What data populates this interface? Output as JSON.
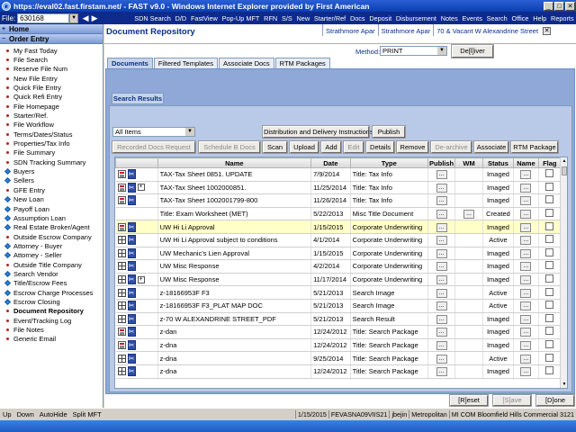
{
  "window": {
    "title": "https://eval02.fast.firstam.net/ - FAST v9.0 - Windows Internet Explorer provided by First American",
    "min": "_",
    "max": "□",
    "close": "✕"
  },
  "topbar": {
    "file_label": "File:",
    "file_number": "630168",
    "nav": [
      "SDN Search",
      "D/D",
      "FastView",
      "Pop-Up MFT",
      "RFN",
      "S/S",
      "New",
      "Starter/Ref",
      "Docs",
      "Deposit",
      "Disbursement",
      "Notes",
      "Events",
      "Search",
      "Office",
      "Help",
      "Reports"
    ]
  },
  "sidebar": {
    "home": "Home",
    "order_entry": "Order Entry",
    "items": [
      {
        "label": "My Fast Today",
        "bullet": "dot"
      },
      {
        "label": "File Search",
        "bullet": "dot"
      },
      {
        "label": "Reserve File Num",
        "bullet": "dot"
      },
      {
        "label": "New File Entry",
        "bullet": "dot"
      },
      {
        "label": "Quick File Entry",
        "bullet": "dot"
      },
      {
        "label": "Quick Refi Entry",
        "bullet": "dot"
      },
      {
        "label": "File Homepage",
        "bullet": "dot"
      },
      {
        "label": "Starter/Ref.",
        "bullet": "dot"
      },
      {
        "label": "File Workflow",
        "bullet": "dot"
      },
      {
        "label": "Terms/Dates/Status",
        "bullet": "dot"
      },
      {
        "label": "Properties/Tax Info",
        "bullet": "dot"
      },
      {
        "label": "File Summary",
        "bullet": "dot"
      },
      {
        "label": "SDN Tracking Summary",
        "bullet": "dot"
      },
      {
        "label": "Buyers",
        "bullet": "diamond"
      },
      {
        "label": "Sellers",
        "bullet": "diamond"
      },
      {
        "label": "GFE Entry",
        "bullet": "dot"
      },
      {
        "label": "New Loan",
        "bullet": "diamond"
      },
      {
        "label": "Payoff Loan",
        "bullet": "diamond"
      },
      {
        "label": "Assumption Loan",
        "bullet": "diamond"
      },
      {
        "label": "Real Estate Broker/Agent",
        "bullet": "diamond"
      },
      {
        "label": "Outside Escrow Company",
        "bullet": "dot"
      },
      {
        "label": "Attorney - Buyer",
        "bullet": "diamond"
      },
      {
        "label": "Attorney - Seller",
        "bullet": "diamond"
      },
      {
        "label": "Outside Title Company",
        "bullet": "dot"
      },
      {
        "label": "Search Vendor",
        "bullet": "diamond"
      },
      {
        "label": "Title/Escrow Fees",
        "bullet": "diamond"
      },
      {
        "label": "Escrow Charge Processes",
        "bullet": "diamond"
      },
      {
        "label": "Escrow Closing",
        "bullet": "diamond"
      },
      {
        "label": "Document Repository",
        "bullet": "dot",
        "active": true
      },
      {
        "label": "Event/Tracking Log",
        "bullet": "dot"
      },
      {
        "label": "File Notes",
        "bullet": "dot"
      },
      {
        "label": "Generic Email",
        "bullet": "dot"
      }
    ]
  },
  "header": {
    "page_title": "Document Repository",
    "cell1": "Strathmore Apar",
    "cell2": "Strathmore Apar",
    "cell3": "70 & Vacant W Alexandrine Street",
    "close": "✕"
  },
  "method": {
    "label": "Method:",
    "value": "PRINT",
    "deliver": "De[l]iver"
  },
  "tabs": [
    "Documents",
    "Filtered Templates",
    "Associate Docs",
    "RTM Packages"
  ],
  "search_results_tab": "Search Results",
  "filter_value": "All Items",
  "buttons": {
    "distribution": "Distribution and Delivery Instructions",
    "publish": "Publish",
    "recorded": "Recorded Docs Request",
    "schedule": "Schedule B Docs",
    "scan": "Scan",
    "upload": "Upload",
    "add": "Add",
    "edit": "Edit",
    "details": "Details",
    "remove": "Remove",
    "dearchive": "De-archive",
    "associate": "Associate",
    "rtm": "RTM Package",
    "reset": "[R]eset",
    "save": "[S]ave",
    "done": "[D]one"
  },
  "table": {
    "columns": [
      "",
      "Name",
      "Date",
      "Type",
      "Publish",
      "WM",
      "Status",
      "Name",
      "Flag"
    ],
    "rows": [
      {
        "icon": "doc",
        "plus": false,
        "name": "TAX-Tax Sheet 0851. UPDATE",
        "date": "7/9/2014",
        "type": "Title: Tax Info",
        "wm": "",
        "status": "Imaged",
        "hl": false
      },
      {
        "icon": "doc",
        "plus": true,
        "name": "TAX-Tax Sheet 1002000851.",
        "date": "11/25/2014",
        "type": "Title: Tax Info",
        "wm": "",
        "status": "Imaged",
        "hl": false
      },
      {
        "icon": "doc",
        "plus": false,
        "name": "TAX-Tax Sheet 1002001799-800",
        "date": "11/26/2014",
        "type": "Title: Tax Info",
        "wm": "",
        "status": "Imaged",
        "hl": false
      },
      {
        "icon": "none",
        "plus": false,
        "name": "Title: Exam Worksheet (MET)",
        "date": "5/22/2013",
        "type": "Misc Title Document",
        "wm": "...",
        "status": "Created",
        "hl": false
      },
      {
        "icon": "doc",
        "plus": false,
        "name": "UW Hi Li Approval",
        "date": "1/15/2015",
        "type": "Corporate Underwriting",
        "wm": "",
        "status": "Imaged",
        "hl": true
      },
      {
        "icon": "grid",
        "plus": false,
        "name": "UW Hi Li Approval subject to conditions",
        "date": "4/1/2014",
        "type": "Corporate Underwriting",
        "wm": "",
        "status": "Active",
        "hl": false
      },
      {
        "icon": "grid",
        "plus": false,
        "name": "UW Mechanic's Lien Approval",
        "date": "1/15/2015",
        "type": "Corporate Underwriting",
        "wm": "",
        "status": "Imaged",
        "hl": false
      },
      {
        "icon": "grid",
        "plus": false,
        "name": "UW Misc Response",
        "date": "4/2/2014",
        "type": "Corporate Underwriting",
        "wm": "",
        "status": "Imaged",
        "hl": false
      },
      {
        "icon": "grid",
        "plus": true,
        "name": "UW Misc Response",
        "date": "11/17/2014",
        "type": "Corporate Underwriting",
        "wm": "",
        "status": "Imaged",
        "hl": false
      },
      {
        "icon": "grid",
        "plus": false,
        "name": "z-18166953F F3",
        "date": "5/21/2013",
        "type": "Search Image",
        "wm": "",
        "status": "Active",
        "hl": false
      },
      {
        "icon": "grid",
        "plus": false,
        "name": "z-18166953F F3_PLAT MAP DOC",
        "date": "5/21/2013",
        "type": "Search Image",
        "wm": "",
        "status": "Active",
        "hl": false
      },
      {
        "icon": "grid",
        "plus": false,
        "name": "z-70 W ALEXANDRINE STREET_PDF",
        "date": "5/21/2013",
        "type": "Search Result",
        "wm": "",
        "status": "Imaged",
        "hl": false
      },
      {
        "icon": "doc",
        "plus": false,
        "name": "z-dan",
        "date": "12/24/2012",
        "type": "Title: Search Package",
        "wm": "",
        "status": "Imaged",
        "hl": false
      },
      {
        "icon": "doc",
        "plus": false,
        "name": "z-dna",
        "date": "12/24/2012",
        "type": "Title: Search Package",
        "wm": "",
        "status": "Imaged",
        "hl": false
      },
      {
        "icon": "grid",
        "plus": false,
        "name": "z-dna",
        "date": "9/25/2014",
        "type": "Title: Search Package",
        "wm": "",
        "status": "Active",
        "hl": false
      },
      {
        "icon": "grid",
        "plus": false,
        "name": "z-dna",
        "date": "12/24/2012",
        "type": "Title: Search Package",
        "wm": "",
        "status": "Imaged",
        "hl": false
      }
    ]
  },
  "statusbar": {
    "left": [
      "Up",
      "Down",
      "AutoHide",
      "Split MFT"
    ],
    "right": [
      "1/15/2015",
      "FEVASNA09VIIS21",
      "jbejin",
      "Metropolitan",
      "MI COM Bloomfield Hills Commercial 3121"
    ]
  }
}
